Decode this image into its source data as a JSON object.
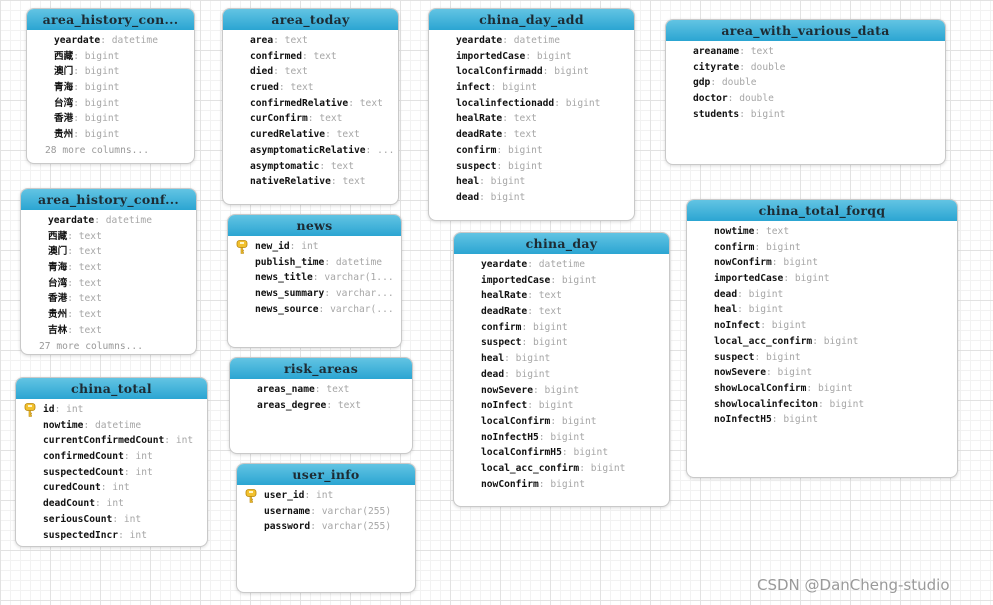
{
  "tables": [
    {
      "name": "area_history_con...",
      "fields": [
        [
          "yeardate",
          "datetime"
        ],
        [
          "西藏",
          "bigint"
        ],
        [
          "澳门",
          "bigint"
        ],
        [
          "青海",
          "bigint"
        ],
        [
          "台湾",
          "bigint"
        ],
        [
          "香港",
          "bigint"
        ],
        [
          "贵州",
          "bigint"
        ]
      ],
      "more": "28 more columns..."
    },
    {
      "name": "area_today",
      "fields": [
        [
          "area",
          "text"
        ],
        [
          "confirmed",
          "text"
        ],
        [
          "died",
          "text"
        ],
        [
          "crued",
          "text"
        ],
        [
          "confirmedRelative",
          "text"
        ],
        [
          "curConfirm",
          "text"
        ],
        [
          "curedRelative",
          "text"
        ],
        [
          "asymptomaticRelative",
          "..."
        ],
        [
          "asymptomatic",
          "text"
        ],
        [
          "nativeRelative",
          "text"
        ]
      ]
    },
    {
      "name": "china_day_add",
      "fields": [
        [
          "yeardate",
          "datetime"
        ],
        [
          "importedCase",
          "bigint"
        ],
        [
          "localConfirmadd",
          "bigint"
        ],
        [
          "infect",
          "bigint"
        ],
        [
          "localinfectionadd",
          "bigint"
        ],
        [
          "healRate",
          "text"
        ],
        [
          "deadRate",
          "text"
        ],
        [
          "confirm",
          "bigint"
        ],
        [
          "suspect",
          "bigint"
        ],
        [
          "heal",
          "bigint"
        ],
        [
          "dead",
          "bigint"
        ]
      ]
    },
    {
      "name": "area_with_various_data",
      "fields": [
        [
          "areaname",
          "text"
        ],
        [
          "cityrate",
          "double"
        ],
        [
          "gdp",
          "double"
        ],
        [
          "doctor",
          "double"
        ],
        [
          "students",
          "bigint"
        ]
      ]
    },
    {
      "name": "area_history_conf...",
      "fields": [
        [
          "yeardate",
          "datetime"
        ],
        [
          "西藏",
          "text"
        ],
        [
          "澳门",
          "text"
        ],
        [
          "青海",
          "text"
        ],
        [
          "台湾",
          "text"
        ],
        [
          "香港",
          "text"
        ],
        [
          "贵州",
          "text"
        ],
        [
          "吉林",
          "text"
        ]
      ],
      "more": "27 more columns..."
    },
    {
      "name": "news",
      "fields": [
        [
          "new_id",
          "int",
          "key"
        ],
        [
          "publish_time",
          "datetime"
        ],
        [
          "news_title",
          "varchar(1..."
        ],
        [
          "news_summary",
          "varchar..."
        ],
        [
          "news_source",
          "varchar(..."
        ]
      ]
    },
    {
      "name": "china_day",
      "fields": [
        [
          "yeardate",
          "datetime"
        ],
        [
          "importedCase",
          "bigint"
        ],
        [
          "healRate",
          "text"
        ],
        [
          "deadRate",
          "text"
        ],
        [
          "confirm",
          "bigint"
        ],
        [
          "suspect",
          "bigint"
        ],
        [
          "heal",
          "bigint"
        ],
        [
          "dead",
          "bigint"
        ],
        [
          "nowSevere",
          "bigint"
        ],
        [
          "noInfect",
          "bigint"
        ],
        [
          "localConfirm",
          "bigint"
        ],
        [
          "noInfectH5",
          "bigint"
        ],
        [
          "localConfirmH5",
          "bigint"
        ],
        [
          "local_acc_confirm",
          "bigint"
        ],
        [
          "nowConfirm",
          "bigint"
        ]
      ]
    },
    {
      "name": "china_total_forqq",
      "fields": [
        [
          "nowtime",
          "text"
        ],
        [
          "confirm",
          "bigint"
        ],
        [
          "nowConfirm",
          "bigint"
        ],
        [
          "importedCase",
          "bigint"
        ],
        [
          "dead",
          "bigint"
        ],
        [
          "heal",
          "bigint"
        ],
        [
          "noInfect",
          "bigint"
        ],
        [
          "local_acc_confirm",
          "bigint"
        ],
        [
          "suspect",
          "bigint"
        ],
        [
          "nowSevere",
          "bigint"
        ],
        [
          "showLocalConfirm",
          "bigint"
        ],
        [
          "showlocalinfeciton",
          "bigint"
        ],
        [
          "noInfectH5",
          "bigint"
        ]
      ]
    },
    {
      "name": "risk_areas",
      "fields": [
        [
          "areas_name",
          "text"
        ],
        [
          "areas_degree",
          "text"
        ]
      ]
    },
    {
      "name": "china_total",
      "fields": [
        [
          "id",
          "int",
          "key"
        ],
        [
          "nowtime",
          "datetime"
        ],
        [
          "currentConfirmedCount",
          "int"
        ],
        [
          "confirmedCount",
          "int"
        ],
        [
          "suspectedCount",
          "int"
        ],
        [
          "curedCount",
          "int"
        ],
        [
          "deadCount",
          "int"
        ],
        [
          "seriousCount",
          "int"
        ],
        [
          "suspectedIncr",
          "int"
        ]
      ]
    },
    {
      "name": "user_info",
      "fields": [
        [
          "user_id",
          "int",
          "key"
        ],
        [
          "username",
          "varchar(255)"
        ],
        [
          "password",
          "varchar(255)"
        ]
      ]
    }
  ],
  "watermark": "CSDN @DanCheng-studio",
  "colors": {
    "header": "#2ba5d2",
    "key_icon": "#f2c12e"
  }
}
